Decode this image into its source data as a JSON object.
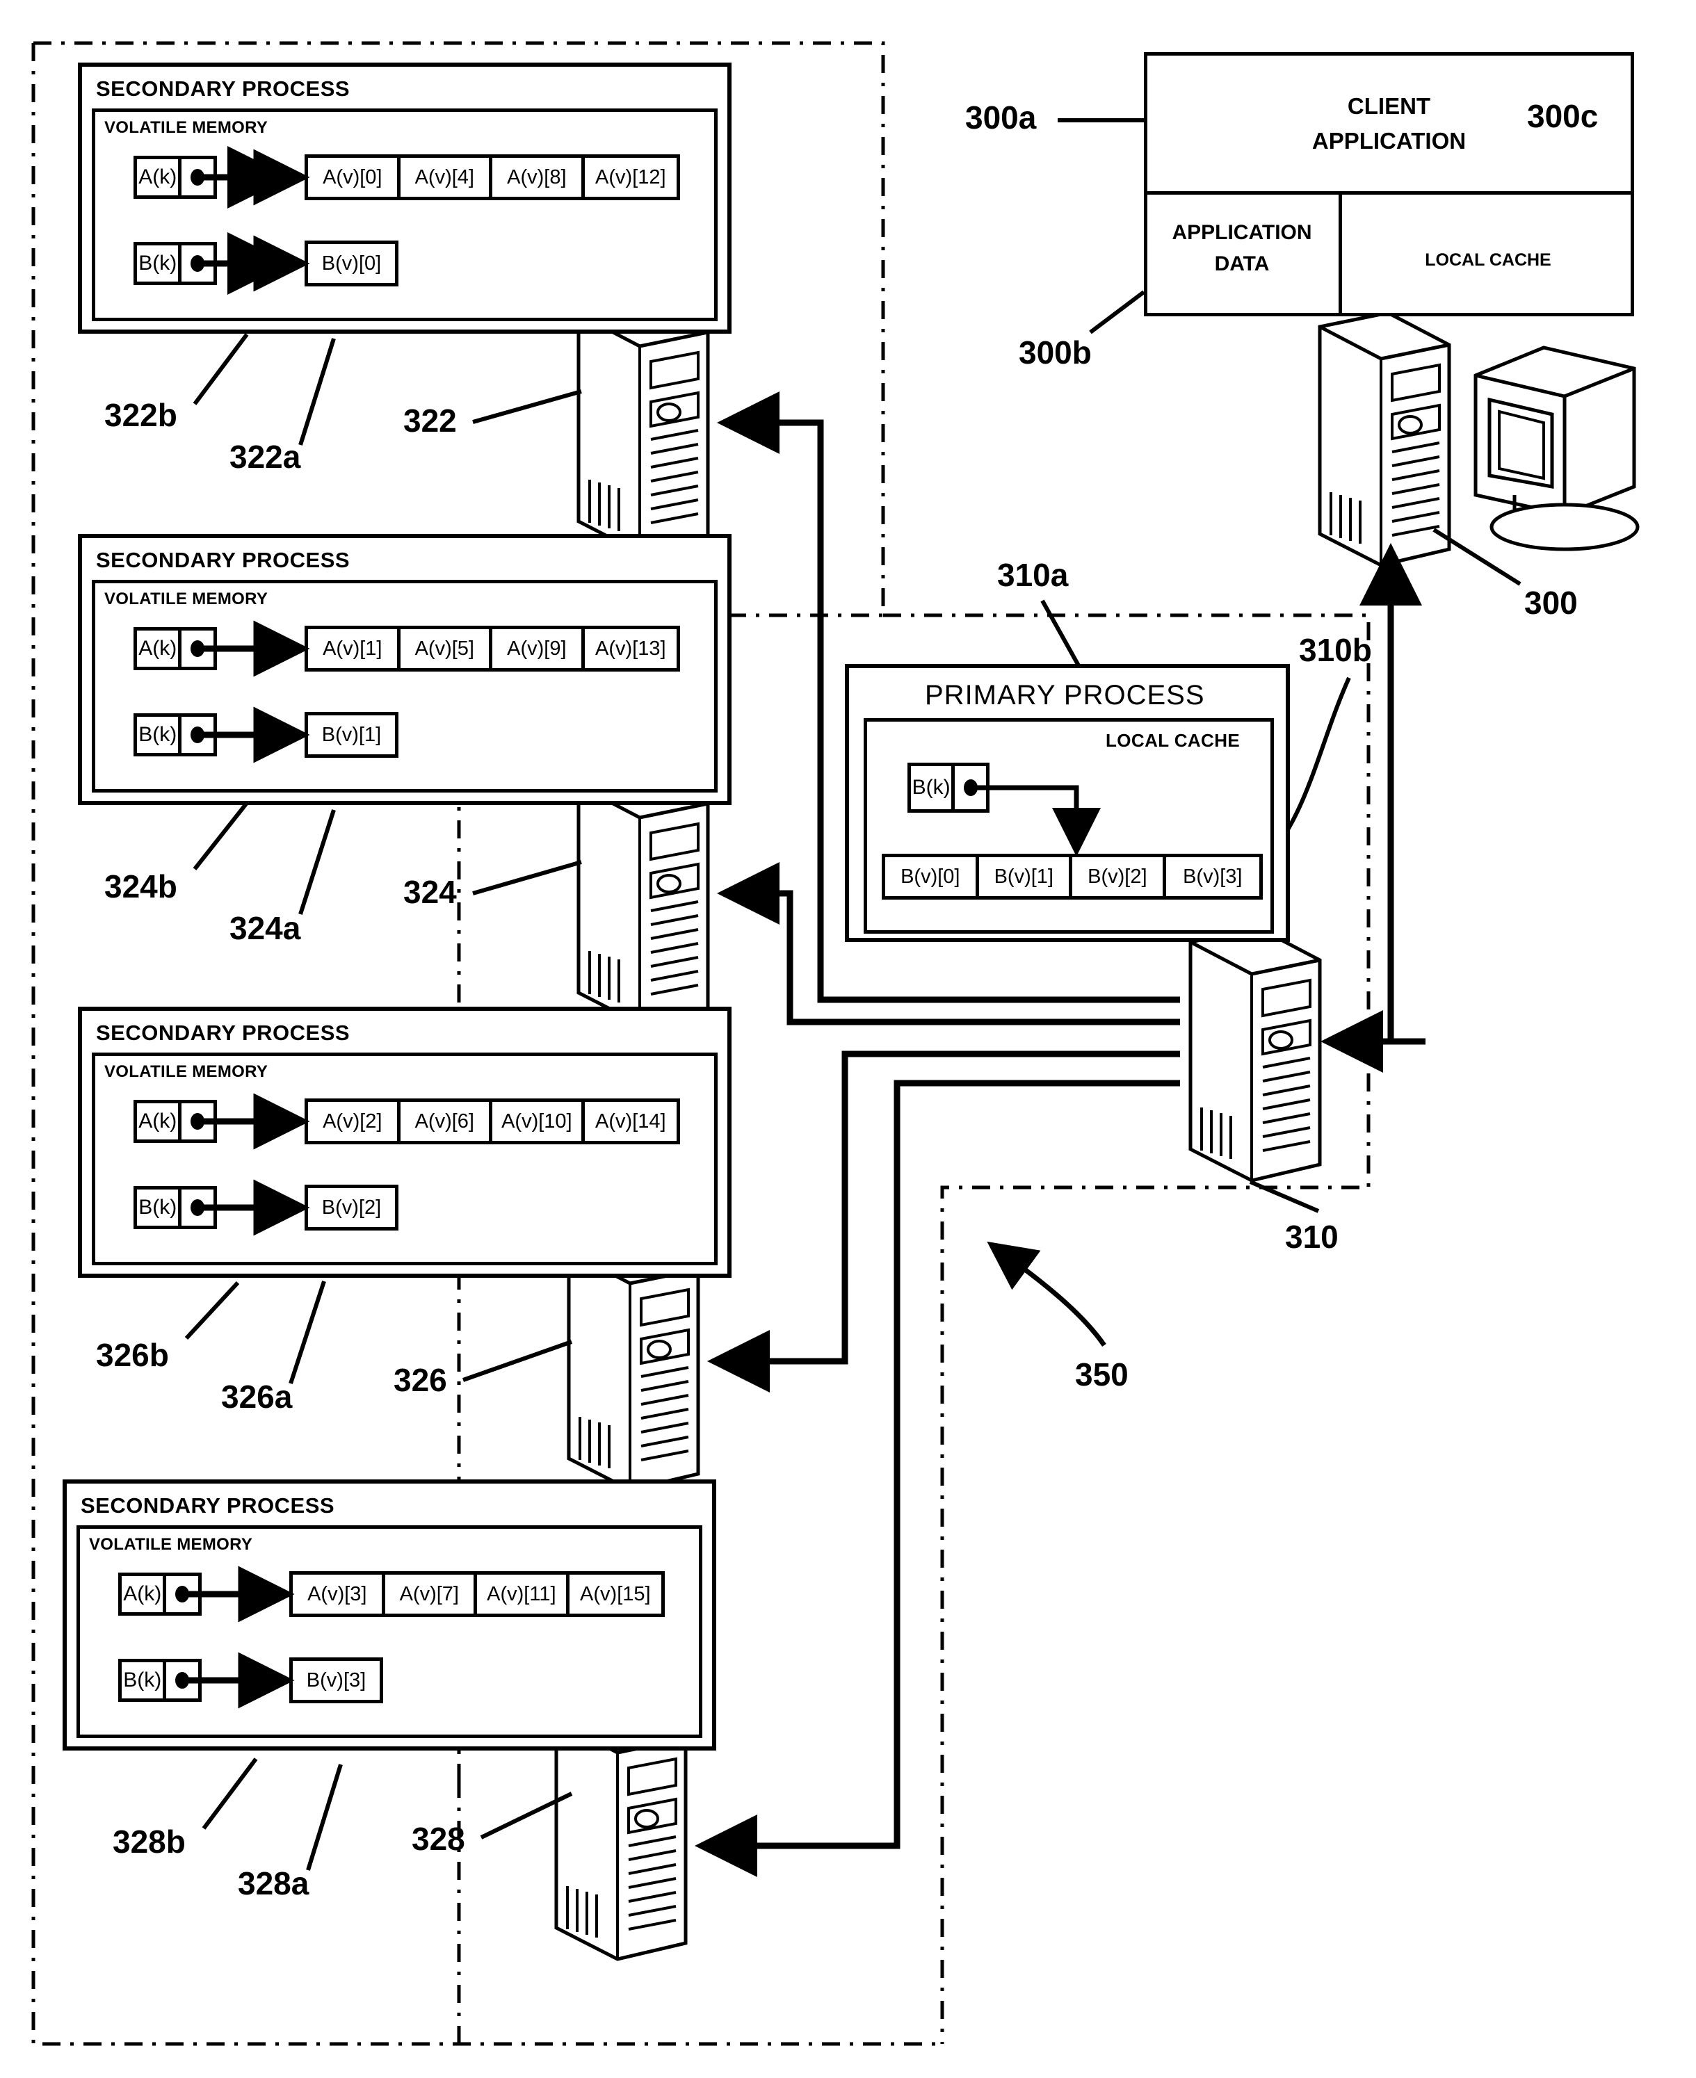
{
  "figure": {
    "title": "Distributed primary/secondary process cache diagram"
  },
  "client": {
    "app_label_line1": "CLIENT",
    "app_label_line2": "APPLICATION",
    "app_data_line1": "APPLICATION",
    "app_data_line2": "DATA",
    "local_cache_label": "LOCAL CACHE",
    "ref_app": "300a",
    "ref_data": "300b",
    "ref_cache": "300c",
    "ref_machine": "300"
  },
  "primary": {
    "process_title": "PRIMARY PROCESS",
    "local_cache_title": "LOCAL CACHE",
    "key": "B(k)",
    "values": [
      "B(v)[0]",
      "B(v)[1]",
      "B(v)[2]",
      "B(v)[3]"
    ],
    "ref_process": "310a",
    "ref_cache": "310b",
    "ref_machine": "310"
  },
  "system": {
    "ref_cluster": "350"
  },
  "secondary_processes": [
    {
      "process_title": "SECONDARY PROCESS",
      "memory_title": "VOLATILE MEMORY",
      "key_a": "A(k)",
      "values_a": [
        "A(v)[0]",
        "A(v)[4]",
        "A(v)[8]",
        "A(v)[12]"
      ],
      "key_b": "B(k)",
      "values_b": [
        "B(v)[0]"
      ],
      "ref_memory": "322b",
      "ref_process": "322a",
      "ref_machine": "322"
    },
    {
      "process_title": "SECONDARY PROCESS",
      "memory_title": "VOLATILE MEMORY",
      "key_a": "A(k)",
      "values_a": [
        "A(v)[1]",
        "A(v)[5]",
        "A(v)[9]",
        "A(v)[13]"
      ],
      "key_b": "B(k)",
      "values_b": [
        "B(v)[1]"
      ],
      "ref_memory": "324b",
      "ref_process": "324a",
      "ref_machine": "324"
    },
    {
      "process_title": "SECONDARY PROCESS",
      "memory_title": "VOLATILE MEMORY",
      "key_a": "A(k)",
      "values_a": [
        "A(v)[2]",
        "A(v)[6]",
        "A(v)[10]",
        "A(v)[14]"
      ],
      "key_b": "B(k)",
      "values_b": [
        "B(v)[2]"
      ],
      "ref_memory": "326b",
      "ref_process": "326a",
      "ref_machine": "326"
    },
    {
      "process_title": "SECONDARY PROCESS",
      "memory_title": "VOLATILE MEMORY",
      "key_a": "A(k)",
      "values_a": [
        "A(v)[3]",
        "A(v)[7]",
        "A(v)[11]",
        "A(v)[15]"
      ],
      "key_b": "B(k)",
      "values_b": [
        "B(v)[3]"
      ],
      "ref_memory": "328b",
      "ref_process": "328a",
      "ref_machine": "328"
    }
  ],
  "colors": {
    "line": "#000000",
    "background": "#ffffff"
  }
}
